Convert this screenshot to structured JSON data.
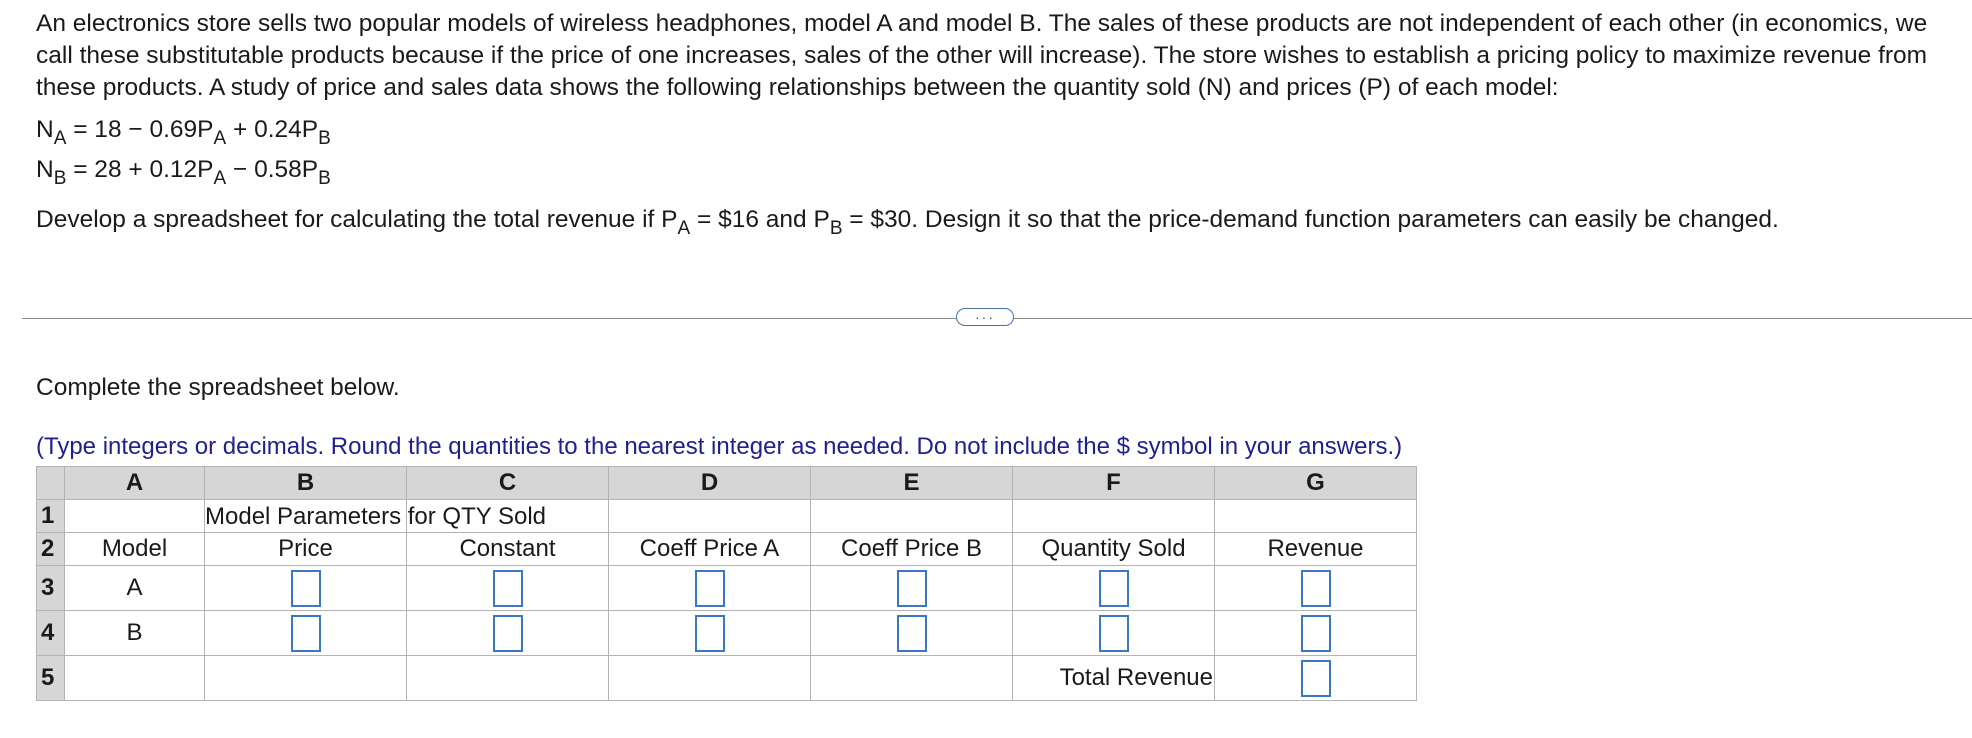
{
  "problem": {
    "intro": "An electronics store sells two popular models of wireless headphones, model A and model B. The sales of these products are not independent of each other (in economics, we call these substitutable products because if the price of one increases, sales of the other will increase). The store wishes to establish a pricing policy to maximize revenue from these products. A study of price and sales data shows the following relationships between the quantity sold (N) and prices (P) of each model:",
    "eq1": {
      "lhs": "N",
      "lhs_sub": "A",
      "mid": " = 18 − 0.69P",
      "mid_sub": "A",
      "tail": " + 0.24P",
      "tail_sub": "B"
    },
    "eq2": {
      "lhs": "N",
      "lhs_sub": "B",
      "mid": " = 28 + 0.12P",
      "mid_sub": "A",
      "tail": " − 0.58P",
      "tail_sub": "B"
    },
    "instruction": {
      "part1": "Develop a spreadsheet for calculating the total revenue if P",
      "sub1": "A",
      "part2": " = $16 and P",
      "sub2": "B",
      "part3": " = $30. Design it so that the price-demand function parameters can easily be changed."
    }
  },
  "more_button": "···",
  "complete_text": "Complete the spreadsheet below.",
  "hint_text": "(Type integers or decimals. Round the quantities to the nearest integer as needed. Do not include the $ symbol in your answers.)",
  "sheet": {
    "columns": [
      "A",
      "B",
      "C",
      "D",
      "E",
      "F",
      "G"
    ],
    "rows": [
      "1",
      "2",
      "3",
      "4",
      "5"
    ],
    "row1_title": "Model Parameters for QTY Sold",
    "row2_headers": [
      "Model",
      "Price",
      "Constant",
      "Coeff Price A",
      "Coeff Price B",
      "Quantity Sold",
      "Revenue"
    ],
    "models": [
      "A",
      "B"
    ],
    "total_label": "Total Revenue"
  }
}
